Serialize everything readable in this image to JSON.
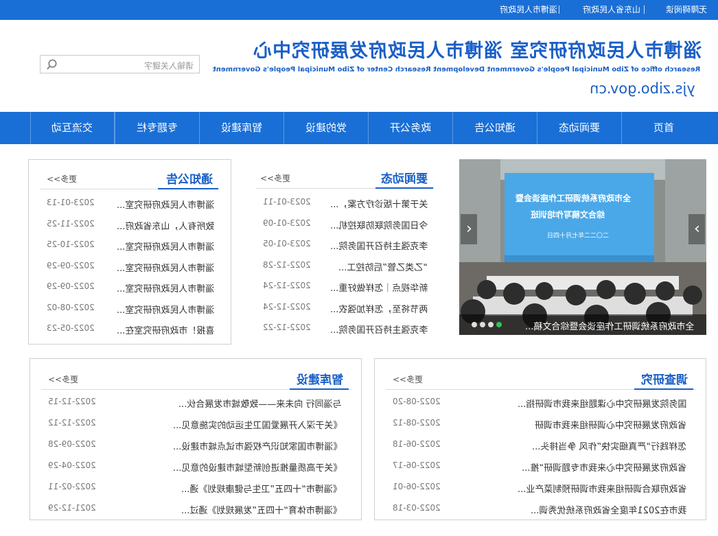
{
  "topbar": {
    "links": [
      "无障碍阅读",
      "山东省人民政府",
      "淄博市人民政府"
    ]
  },
  "header": {
    "title_cn": "淄博市人民政府研究室  淄博市人民政府发展研究中心",
    "title_en": "Research office of Zibo Municipal People's Government    Development Research Center of Zibo Municipal People's Government",
    "domain": "yjs.zibo.gov.cn",
    "search_placeholder": "请输入关键字"
  },
  "nav": {
    "items": [
      "首页",
      "要闻动态",
      "通知公告",
      "政务公开",
      "党的建设",
      "智库建设",
      "专题专栏",
      "交流互动"
    ]
  },
  "slider": {
    "caption": "全市政府系统调研工作座谈会暨综合文稿...",
    "screen_line1": "全市政府系统调研工作座谈会暨",
    "screen_line2": "综合文稿写作培训班",
    "screen_line3": "二〇二二年七月十四日",
    "prev_icon": "chevron-left-icon",
    "next_icon": "chevron-right-icon"
  },
  "news": {
    "title": "要闻动态",
    "more": "更多>>",
    "items": [
      {
        "text": "关于第十版诊疗方案，...",
        "date": "2023-01-11"
      },
      {
        "text": "今日国务院联防联控机...",
        "date": "2023-01-09"
      },
      {
        "text": "李克强主持召开国务院...",
        "date": "2023-01-05"
      },
      {
        "text": "“乙类乙管”后防控工...",
        "date": "2022-12-28"
      },
      {
        "text": "新华视点｜怎样做好重...",
        "date": "2022-12-24"
      },
      {
        "text": "两节将至，怎样加强农...",
        "date": "2022-12-24"
      },
      {
        "text": "李克强主持召开国务院...",
        "date": "2022-12-22"
      }
    ]
  },
  "notice": {
    "title": "通知公告",
    "more": "更多>>",
    "items": [
      {
        "text": "淄博市人民政府研究室...",
        "date": "2023-01-13"
      },
      {
        "text": "致所有人，山东省政府...",
        "date": "2022-11-25"
      },
      {
        "text": "淄博市人民政府研究室...",
        "date": "2022-10-25"
      },
      {
        "text": "淄博市人民政府研究室...",
        "date": "2022-09-29"
      },
      {
        "text": "淄博市人民政府研究室...",
        "date": "2022-09-29"
      },
      {
        "text": "淄博市人民政府研究室...",
        "date": "2022-08-02"
      },
      {
        "text": "喜报！市政府研究室在...",
        "date": "2022-05-23"
      }
    ]
  },
  "research": {
    "title": "调查研究",
    "more": "更多>>",
    "items": [
      {
        "text": "国务院发展研究中心课题组来我市调研指...",
        "date": "2022-08-20"
      },
      {
        "text": "省政府发展研究中心调研组来我市调研",
        "date": "2022-08-12"
      },
      {
        "text": "怎样践行“严真细实快”作风 争当排头...",
        "date": "2022-06-18"
      },
      {
        "text": "省政府发展研究中心来我市专题调研“推...",
        "date": "2022-06-17"
      },
      {
        "text": "省政府联合调研组来我市调研预制菜产业...",
        "date": "2022-06-01"
      },
      {
        "text": "我市在2021年度全省政府系统优秀调...",
        "date": "2022-03-18"
      }
    ]
  },
  "think": {
    "title": "智库建设",
    "more": "更多>>",
    "items": [
      {
        "text": "与淄同行 向未来——致敬城市发展合伙...",
        "date": "2022-12-15"
      },
      {
        "text": "《关于深入开展爱国卫生运动的实施意见...",
        "date": "2022-12-12"
      },
      {
        "text": "《淄博市国家知识产权强市试点城市建设...",
        "date": "2022-09-28"
      },
      {
        "text": "《关于高质量推进创新型城市建设的意见...",
        "date": "2022-04-29"
      },
      {
        "text": "《淄博市“十四五”卫生与健康规划》通...",
        "date": "2022-02-11"
      },
      {
        "text": "《淄博市体育“十四五”发展规划》通过...",
        "date": "2021-12-29"
      }
    ]
  },
  "colors": {
    "brand_blue": "#1a6fd6",
    "title_blue": "#1a5fc6",
    "active_dot": "#33c25a"
  }
}
